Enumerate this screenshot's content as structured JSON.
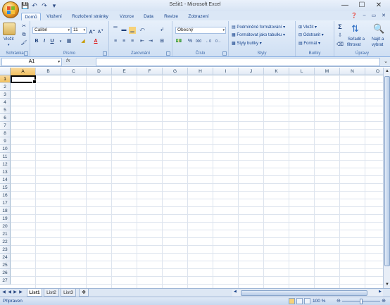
{
  "window": {
    "title": "Sešit1 - Microsoft Excel"
  },
  "tabs": [
    "Domů",
    "Vložení",
    "Rozložení stránky",
    "Vzorce",
    "Data",
    "Revize",
    "Zobrazení"
  ],
  "ribbon": {
    "clipboard": {
      "paste_label": "Vložit",
      "group_label": "Schránka"
    },
    "font": {
      "font_name": "Calibri",
      "font_size": "11",
      "bold": "B",
      "italic": "I",
      "underline": "U",
      "group_label": "Písmo"
    },
    "alignment": {
      "group_label": "Zarovnání"
    },
    "number": {
      "format": "Obecný",
      "group_label": "Číslo"
    },
    "styles": {
      "conditional": "Podmíněné formátování",
      "as_table": "Formátovat jako tabulku",
      "cell_styles": "Styly buňky",
      "group_label": "Styly"
    },
    "cells": {
      "insert": "Vložit",
      "delete": "Odstranit",
      "format": "Formát",
      "group_label": "Buňky"
    },
    "editing": {
      "sort_filter_1": "Seřadit a",
      "sort_filter_2": "filtrovat",
      "find_select_1": "Najít a",
      "find_select_2": "vybrat",
      "group_label": "Úpravy"
    }
  },
  "formula_bar": {
    "name_box": "A1",
    "fx": "fx",
    "value": ""
  },
  "columns": [
    "A",
    "B",
    "C",
    "D",
    "E",
    "F",
    "G",
    "H",
    "I",
    "J",
    "K",
    "L",
    "M",
    "N",
    "O"
  ],
  "rows": [
    "1",
    "2",
    "3",
    "4",
    "5",
    "6",
    "7",
    "8",
    "9",
    "10",
    "11",
    "12",
    "13",
    "14",
    "15",
    "16",
    "17",
    "18",
    "19",
    "20",
    "21",
    "22",
    "23",
    "24",
    "25",
    "26",
    "27"
  ],
  "sheets": [
    "List1",
    "List2",
    "List3"
  ],
  "status": {
    "mode": "Připraven",
    "zoom": "100 %"
  }
}
